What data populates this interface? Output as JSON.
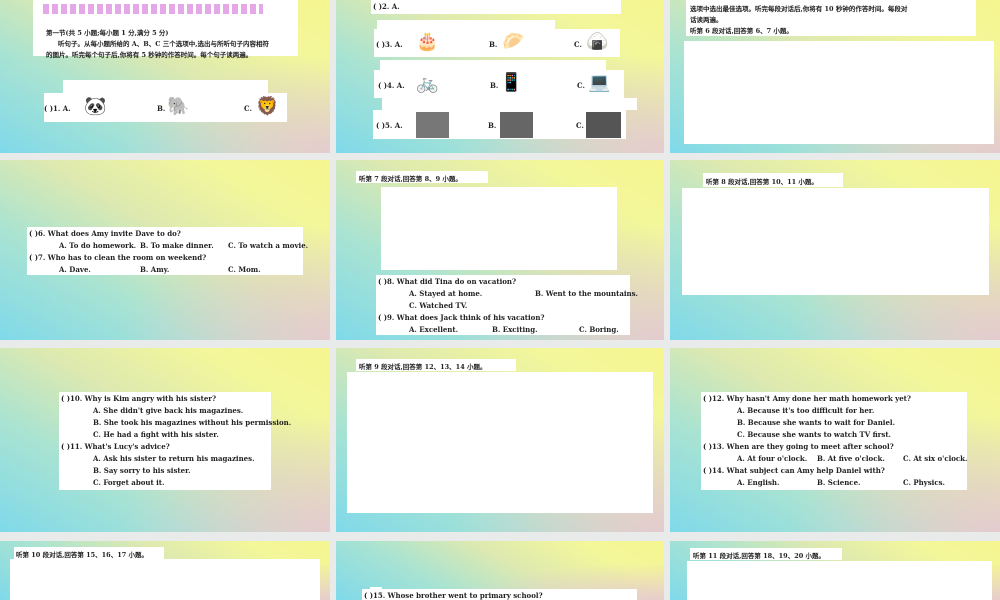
{
  "slide1": {
    "line1": "第一节(共 5 小题;每小题 1 分,满分 5 分)",
    "line2": "听句子。从每小题所给的 A、B、C 三个选项中,选出与所听句子内容相符",
    "line3": "的图片。听完每个句子后,你将有 5 秒钟的作答时间。每个句子读两遍。",
    "q1": "(    )1. A.",
    "b": "B.",
    "c": "C."
  },
  "slide2": {
    "q2": "(    )2. A.",
    "q3": "(    )3. A.",
    "q4": "(    )4. A.",
    "q5": "(    )5. A.",
    "b": "B.",
    "c": "C."
  },
  "slide3": {
    "line1": "选项中选出最佳选项。听完每段对话后,你将有 10 秒钟的作答时间。每段对",
    "line2": "话读两遍。",
    "line3": "听第 6 段对话,回答第 6、7 小题。"
  },
  "slide4": {
    "lines": [
      "(    )6. What does Amy invite Dave to do?",
      "A. To do homework.",
      "B. To make dinner.",
      "C. To watch a movie.",
      "(    )7. Who has to clean the room on weekend?",
      "A. Dave.",
      "B. Amy.",
      "C. Mom."
    ]
  },
  "slide5": {
    "header": "听第 7 段对话,回答第 8、9 小题。",
    "lines": [
      "(    )8. What did Tina do on vacation?",
      "A. Stayed at home.",
      "B. Went to the mountains.",
      "C. Watched TV.",
      "(    )9. What does Jack think of his vacation?",
      "A. Excellent.",
      "B. Exciting.",
      "C. Boring."
    ]
  },
  "slide6": {
    "header": "听第 8 段对话,回答第 10、11 小题。"
  },
  "slide7": {
    "lines": [
      "(    )10. Why is Kim angry with his sister?",
      "A. She didn't give back his magazines.",
      "B. She took his magazines without his permission.",
      "C. He had a fight with his sister.",
      "(    )11. What's Lucy's advice?",
      "A. Ask his sister to return his magazines.",
      "B. Say sorry to his sister.",
      "C. Forget about it."
    ]
  },
  "slide8": {
    "header": "听第 9 段对话,回答第 12、13、14 小题。"
  },
  "slide9": {
    "lines": [
      "(    )12. Why hasn't Amy done her math homework yet?",
      "A. Because it's too difficult for her.",
      "B. Because she wants to wait for Daniel.",
      "C. Because she wants to watch TV first.",
      "(    )13. When are they going to meet after school?",
      "A. At four o'clock.",
      "B. At five o'clock.",
      "C. At six o'clock.",
      "(    )14. What subject can Amy help Daniel with?",
      "A. English.",
      "B. Science.",
      "C. Physics."
    ]
  },
  "slide10": {
    "header": "听第 10 段对话,回答第 15、16、17 小题。"
  },
  "slide11": {
    "q15": "(    )15. Whose brother went to primary school?"
  },
  "slide12": {
    "header": "听第 11 段对话,回答第 18、19、20 小题。"
  }
}
